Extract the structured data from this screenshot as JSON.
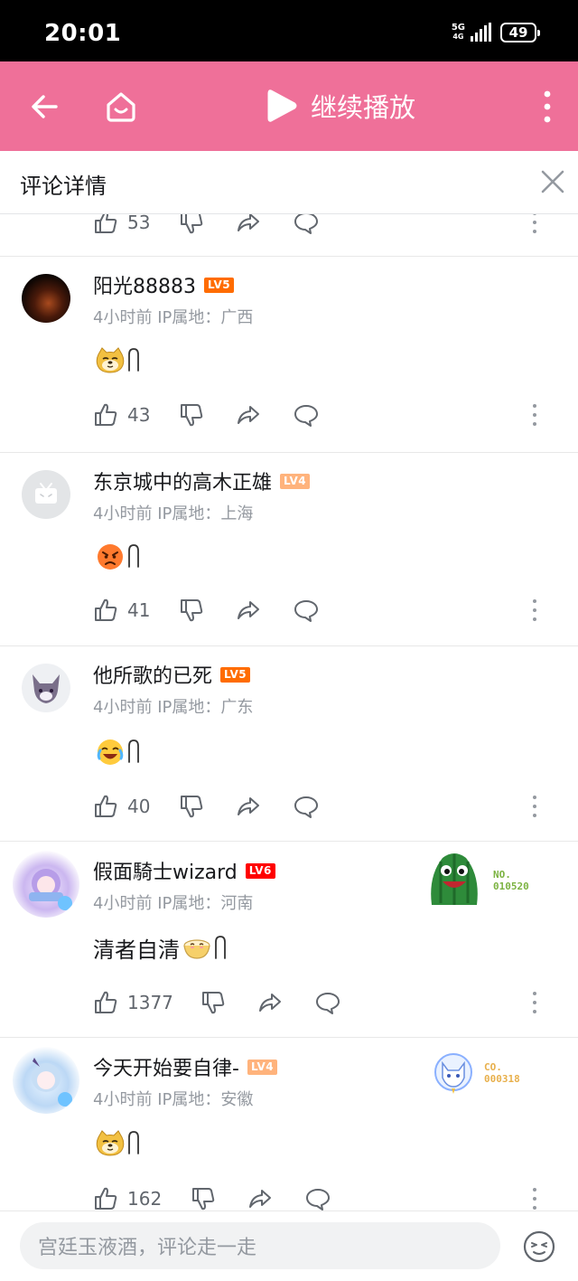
{
  "status_bar": {
    "time": "20:01",
    "network": "5G",
    "network_sub": "4G",
    "battery": "49"
  },
  "top_bar": {
    "play_label": "继续播放"
  },
  "panel": {
    "title": "评论详情"
  },
  "comments": [
    {
      "partial": true,
      "likes": "53"
    },
    {
      "username": "阳光88883",
      "level": "LV5",
      "level_color": "#ff6c00",
      "time": "4小时前",
      "ip": "IP属地：广西",
      "text": "",
      "emoji": "doge",
      "likes": "43"
    },
    {
      "username": "东京城中的高木正雄",
      "level": "LV4",
      "level_color": "#ffb37c",
      "time": "4小时前",
      "ip": "IP属地：上海",
      "text": "",
      "emoji": "angry",
      "likes": "41"
    },
    {
      "username": "他所歌的已死",
      "level": "LV5",
      "level_color": "#ff6c00",
      "time": "4小时前",
      "ip": "IP属地：广东",
      "text": "",
      "emoji": "laugh-cry",
      "likes": "40"
    },
    {
      "username": "假面騎士wizard",
      "level": "LV6",
      "level_color": "#ff0000",
      "time": "4小时前",
      "ip": "IP属地：河南",
      "text": "清者自清",
      "emoji": "bowl",
      "likes": "1377",
      "fan_no_label": "NO.",
      "fan_no_value": "010520",
      "fan_no_color": "#7cb342"
    },
    {
      "username": "今天开始要自律-",
      "level": "LV4",
      "level_color": "#ffb37c",
      "time": "4小时前",
      "ip": "IP属地：安徽",
      "text": "",
      "emoji": "doge",
      "likes": "162",
      "fan_no_label": "CO.",
      "fan_no_value": "000318",
      "fan_no_color": "#e8b04c"
    }
  ],
  "bottom_bar": {
    "placeholder": "宫廷玉液酒，评论走一走"
  },
  "colors": {
    "brand_pink": "#ef7099",
    "text_primary": "#18191c",
    "text_secondary": "#9499a0",
    "icon_gray": "#61666d"
  }
}
